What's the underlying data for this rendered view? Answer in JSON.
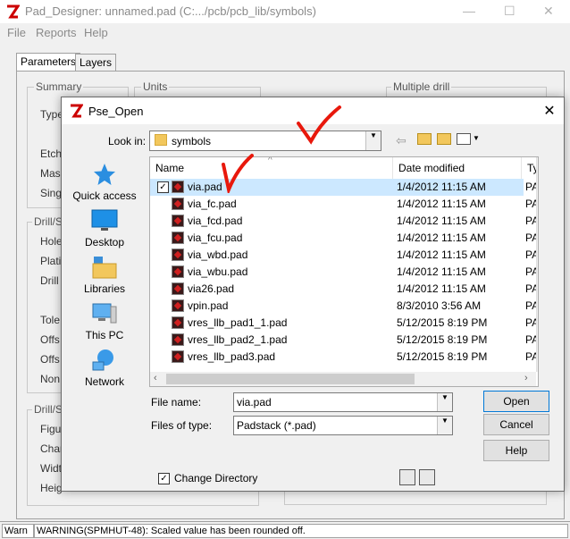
{
  "app": {
    "title": "Pad_Designer: unnamed.pad (C:.../pcb/pcb_lib/symbols)",
    "menu": [
      "File",
      "Reports",
      "Help"
    ],
    "tabs": [
      "Parameters",
      "Layers"
    ],
    "groups": {
      "summary": "Summary",
      "units": "Units",
      "multiple_drill": "Multiple drill",
      "drill1": "Drill/S",
      "drill2": "Drill/S"
    },
    "labels": [
      "Type",
      "Etch",
      "Mas",
      "Sing",
      "Hole",
      "Plati",
      "Drill",
      "Tole",
      "Offs",
      "Offs",
      "Non",
      "Figu",
      "Char",
      "Widt",
      "Heig"
    ],
    "status": {
      "mode": "Warn",
      "message": "WARNING(SPMHUT-48): Scaled value has been rounded off."
    }
  },
  "dialog": {
    "title": "Pse_Open",
    "close_symbol": "✕",
    "look_in_label": "Look in:",
    "look_in_value": "symbols",
    "places": [
      {
        "label": "Quick access",
        "icon": "star-icon"
      },
      {
        "label": "Desktop",
        "icon": "desktop-icon"
      },
      {
        "label": "Libraries",
        "icon": "libraries-icon"
      },
      {
        "label": "This PC",
        "icon": "computer-icon"
      },
      {
        "label": "Network",
        "icon": "network-icon"
      }
    ],
    "columns": {
      "name": "Name",
      "date": "Date modified",
      "type": "Ty"
    },
    "files": [
      {
        "name": "via.pad",
        "date": "1/4/2012 11:15 AM",
        "type": "PA",
        "selected": true
      },
      {
        "name": "via_fc.pad",
        "date": "1/4/2012 11:15 AM",
        "type": "PA"
      },
      {
        "name": "via_fcd.pad",
        "date": "1/4/2012 11:15 AM",
        "type": "PA"
      },
      {
        "name": "via_fcu.pad",
        "date": "1/4/2012 11:15 AM",
        "type": "PA"
      },
      {
        "name": "via_wbd.pad",
        "date": "1/4/2012 11:15 AM",
        "type": "PA"
      },
      {
        "name": "via_wbu.pad",
        "date": "1/4/2012 11:15 AM",
        "type": "PA"
      },
      {
        "name": "via26.pad",
        "date": "1/4/2012 11:15 AM",
        "type": "PA"
      },
      {
        "name": "vpin.pad",
        "date": "8/3/2010 3:56 AM",
        "type": "PA"
      },
      {
        "name": "vres_llb_pad1_1.pad",
        "date": "5/12/2015 8:19 PM",
        "type": "PA"
      },
      {
        "name": "vres_llb_pad2_1.pad",
        "date": "5/12/2015 8:19 PM",
        "type": "PA"
      },
      {
        "name": "vres_llb_pad3.pad",
        "date": "5/12/2015 8:19 PM",
        "type": "PA"
      }
    ],
    "file_name_label": "File name:",
    "file_name_value": "via.pad",
    "file_type_label": "Files of type:",
    "file_type_value": "Padstack (*.pad)",
    "buttons": {
      "open": "Open",
      "cancel": "Cancel",
      "help": "Help"
    },
    "change_dir_label": "Change Directory",
    "change_dir_checked": true
  }
}
